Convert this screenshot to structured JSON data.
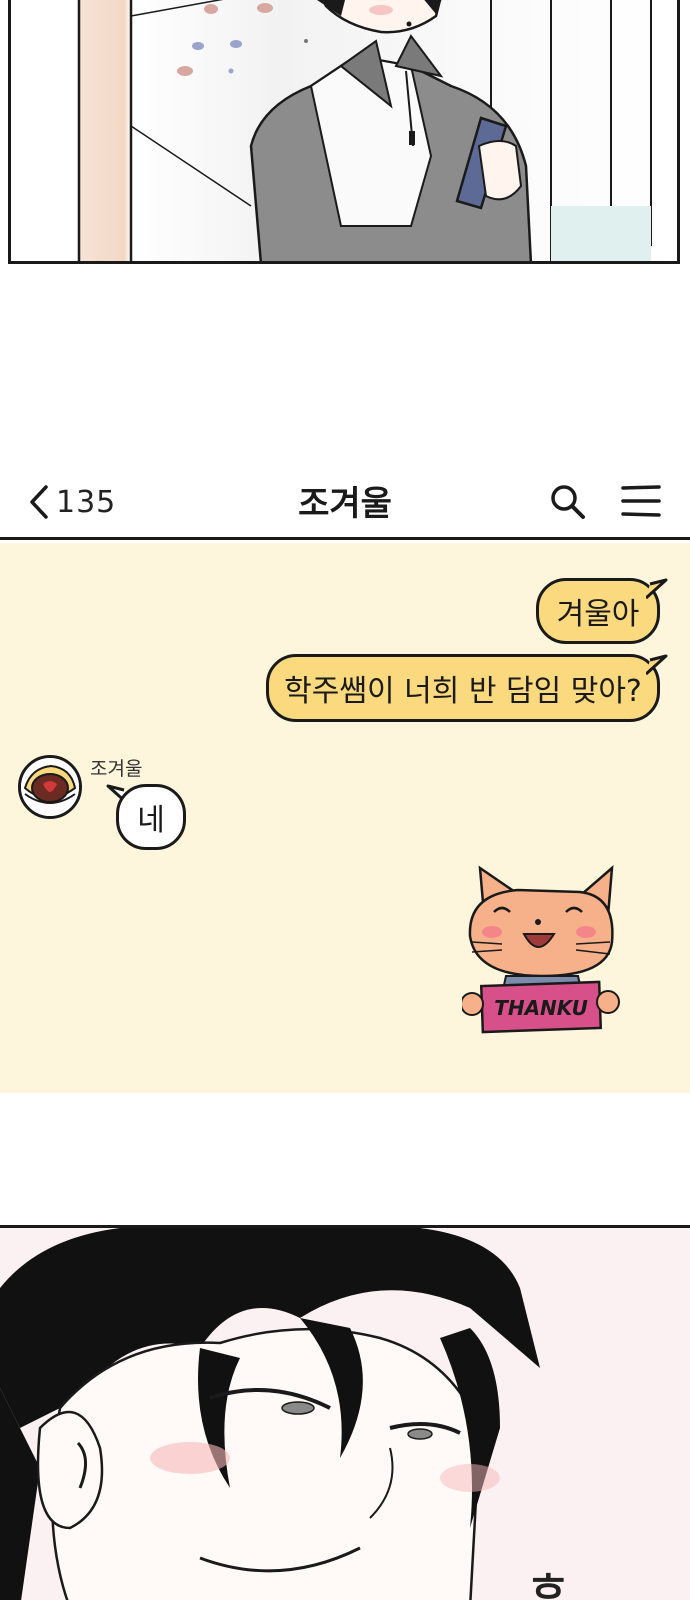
{
  "chat": {
    "back_count": "135",
    "title": "조겨울",
    "messages_sent": [
      "겨울아",
      "학주쌤이 너희 반 담임 맞아?"
    ],
    "sender_name": "조겨울",
    "message_received": "네",
    "sticker_text": "THANKU"
  },
  "panel_bottom": {
    "sfx": "흐"
  },
  "colors": {
    "chat_background": "#fdf5dc",
    "my_bubble": "#fbd97e",
    "other_bubble": "#ffffff",
    "sticker_sign": "#d8508a",
    "cat": "#f7b18a"
  },
  "icons": [
    "chevron-left-icon",
    "search-icon",
    "hamburger-menu-icon"
  ]
}
